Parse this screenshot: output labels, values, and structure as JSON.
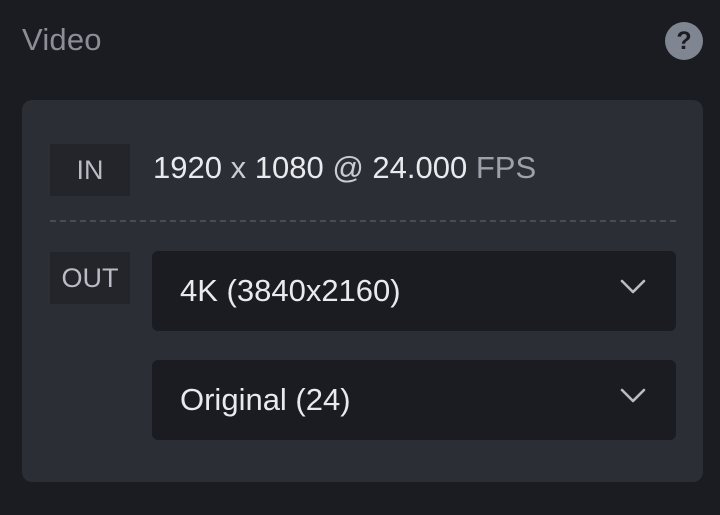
{
  "header": {
    "title": "Video",
    "help_label": "?"
  },
  "input": {
    "tag": "IN",
    "width": "1920",
    "times": "x",
    "height": "1080",
    "at": "@",
    "fps_value": "24.000",
    "fps_unit": "FPS"
  },
  "output": {
    "tag": "OUT",
    "resolution_selected": "4K (3840x2160)",
    "framerate_selected": "Original (24)"
  },
  "icons": {
    "help": "question-mark-icon",
    "dropdown": "chevron-down-icon"
  },
  "colors": {
    "background": "#1b1c21",
    "card": "#2c2e36",
    "text": "#e9eaee",
    "muted": "#8b8e97"
  }
}
